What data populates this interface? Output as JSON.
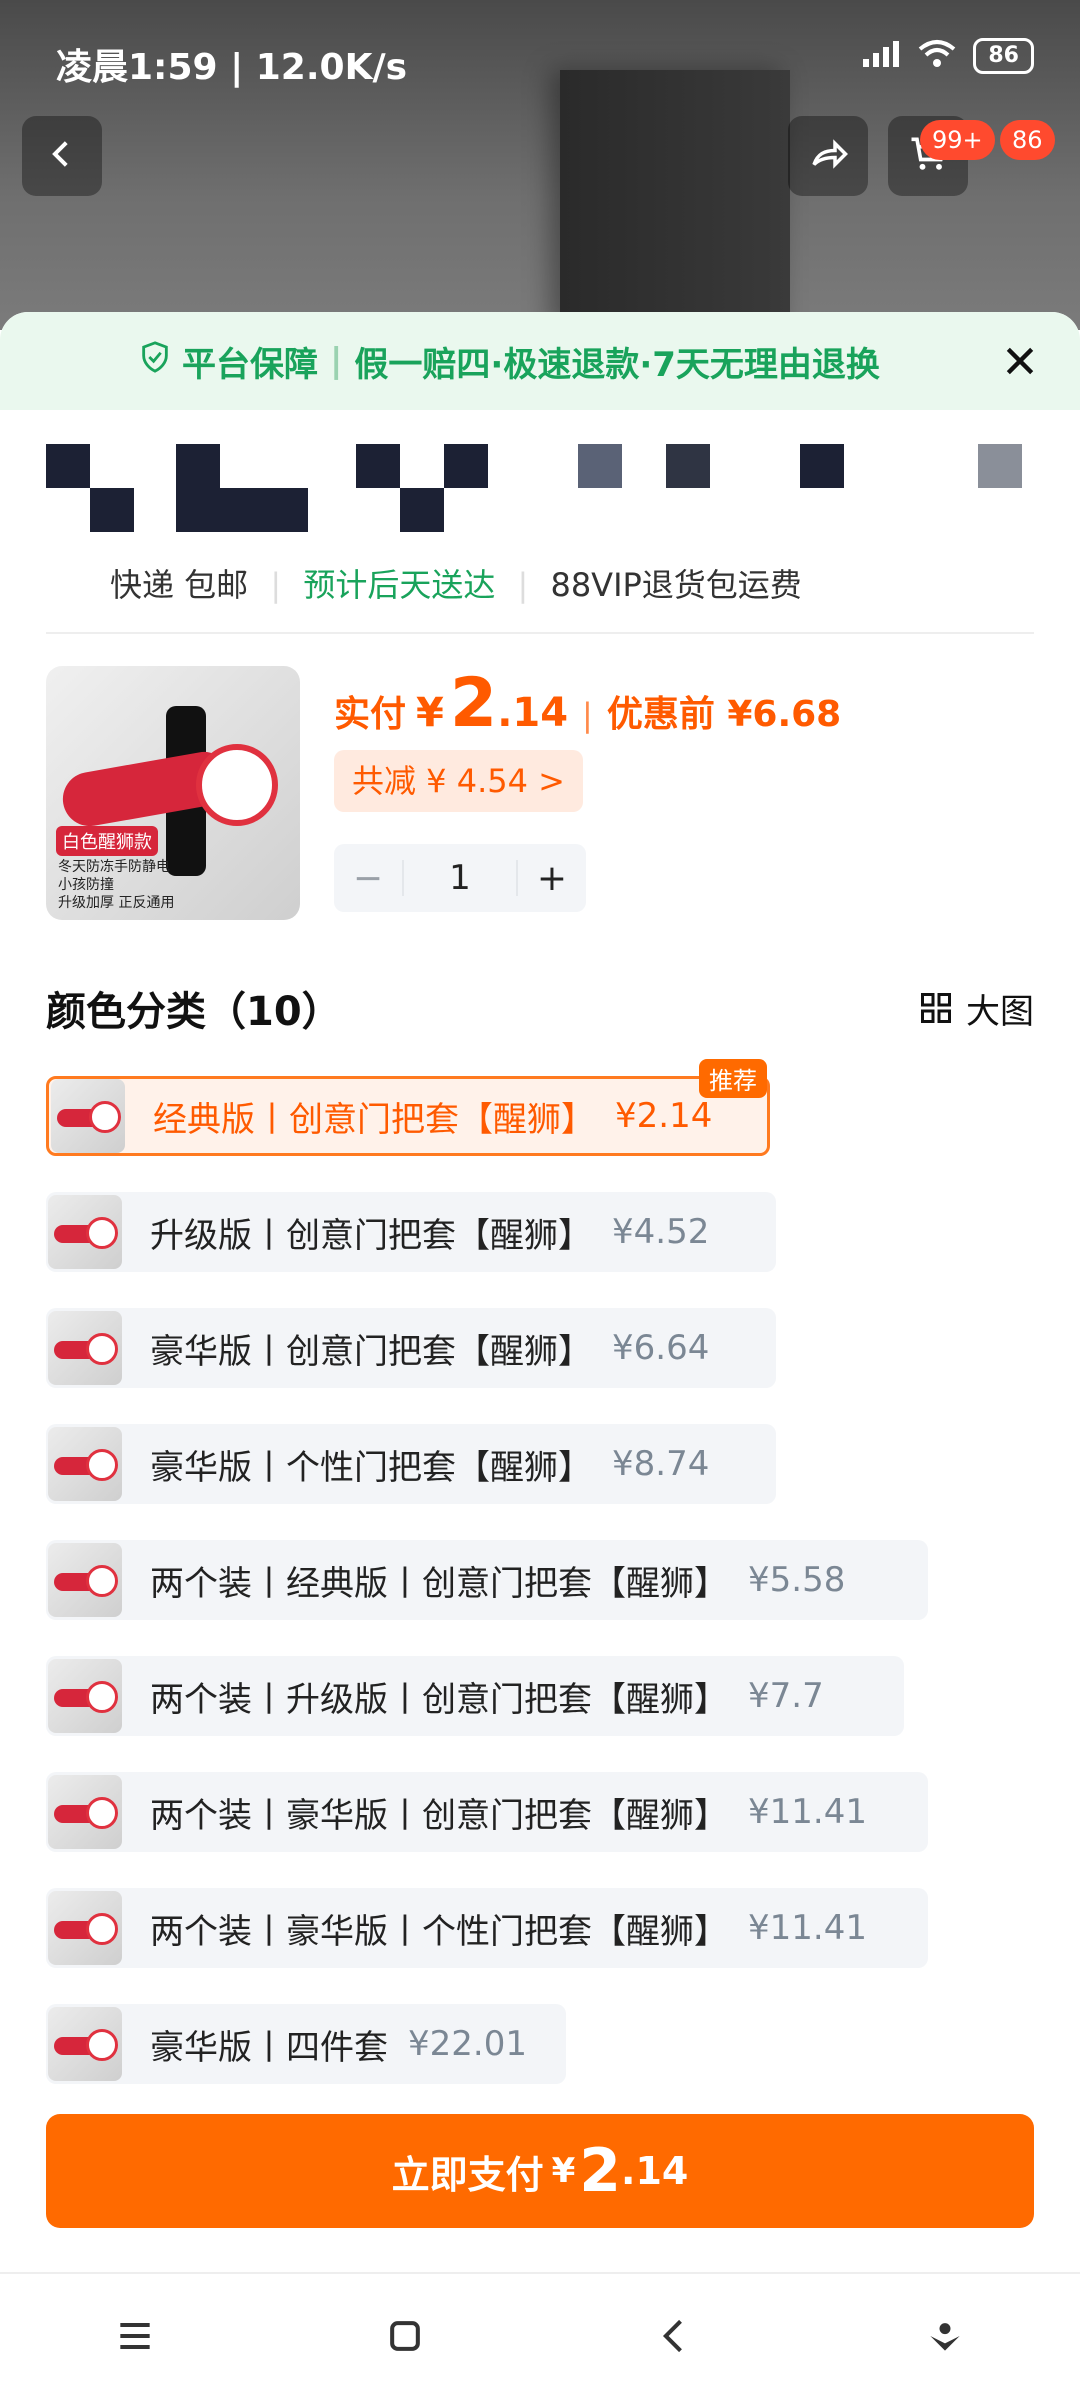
{
  "status": {
    "time": "凌晨1:59 | 12.0K/s",
    "battery": "86"
  },
  "top": {
    "cart_badge": "99+",
    "msg_badge": "86"
  },
  "guarantee": {
    "icon": "shield-check-icon",
    "platform": "平台保障",
    "text": "假一赔四·极速退款·7天无理由退换"
  },
  "shipping": {
    "express": "快递 包邮",
    "eta": "预计后天送达",
    "vip": "88VIP退货包运费"
  },
  "product": {
    "thumb_tag": "白色醒狮款",
    "thumb_bullets": [
      "冬天防冻手防静电",
      "小孩防撞",
      "升级加厚 正反通用"
    ],
    "pay_label": "实付",
    "currency": "¥",
    "price_int": "2",
    "price_dec": ".14",
    "before_label": "优惠前 ¥6.68",
    "discount": "共减 ¥ 4.54 >",
    "qty": "1"
  },
  "section": {
    "title": "颜色分类（10）",
    "view_label": "大图"
  },
  "options": [
    {
      "name": "经典版丨创意门把套【醒狮】",
      "price": "¥2.14",
      "selected": true,
      "badge": "推荐"
    },
    {
      "name": "升级版丨创意门把套【醒狮】",
      "price": "¥4.52"
    },
    {
      "name": "豪华版丨创意门把套【醒狮】",
      "price": "¥6.64"
    },
    {
      "name": "豪华版丨个性门把套【醒狮】",
      "price": "¥8.74"
    },
    {
      "name": "两个装丨经典版丨创意门把套【醒狮】",
      "price": "¥5.58"
    },
    {
      "name": "两个装丨升级版丨创意门把套【醒狮】",
      "price": "¥7.7"
    },
    {
      "name": "两个装丨豪华版丨创意门把套【醒狮】",
      "price": "¥11.41"
    },
    {
      "name": "两个装丨豪华版丨个性门把套【醒狮】",
      "price": "¥11.41"
    },
    {
      "name": "豪华版丨四件套",
      "price": "¥22.01"
    }
  ],
  "pay_button": {
    "label": "立即支付",
    "currency": "¥",
    "int": "2",
    "dec": ".14"
  },
  "colors": {
    "accent": "#ff6a00",
    "green": "#19a35b"
  }
}
